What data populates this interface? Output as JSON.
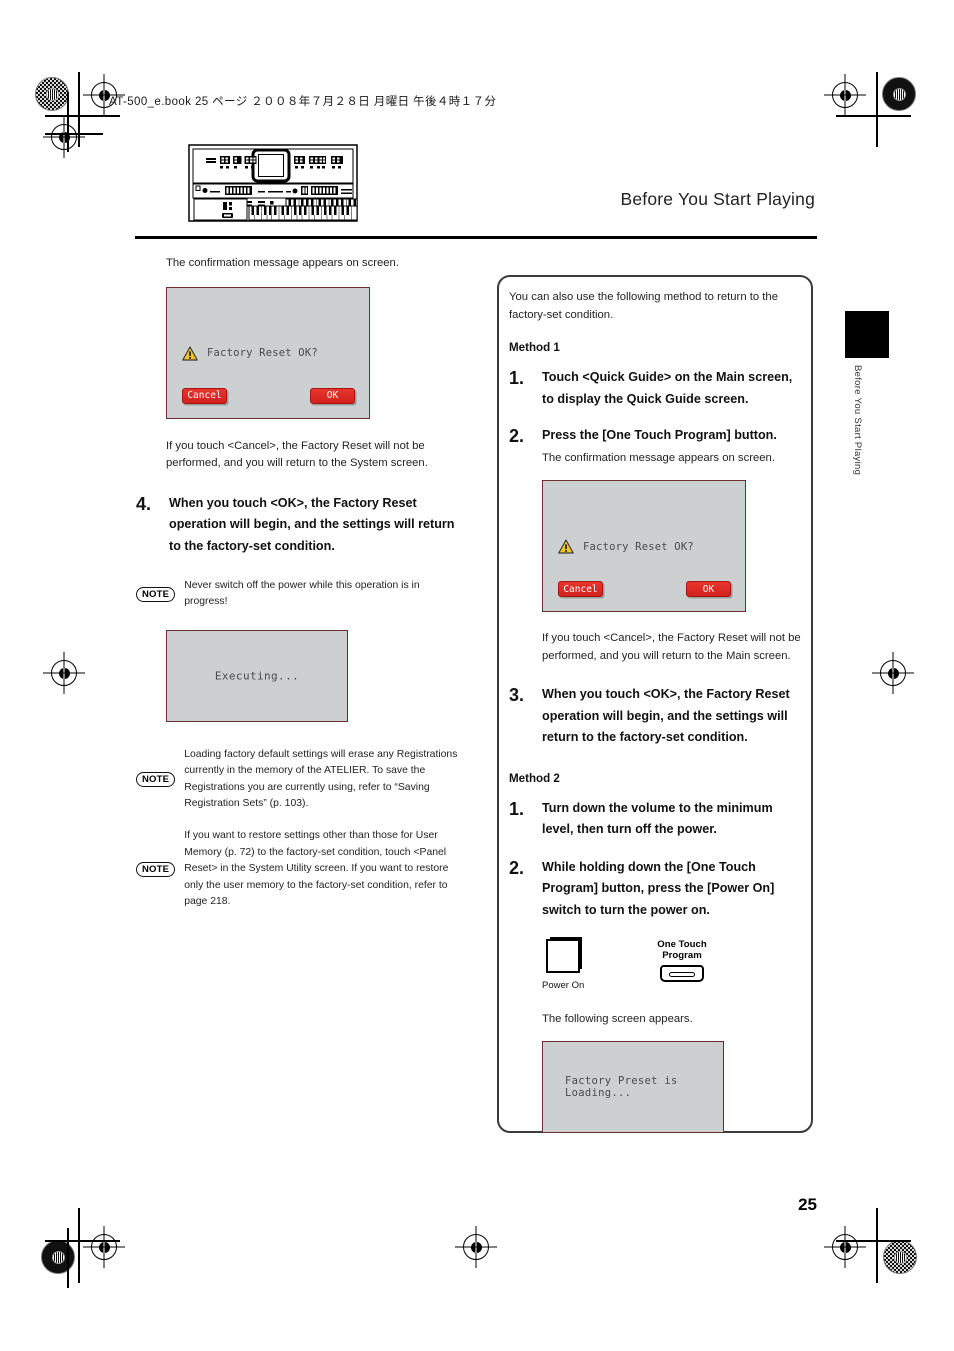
{
  "print": {
    "file_header": "AT-500_e.book 25 ページ ２００８年７月２８日 月曜日 午後４時１７分",
    "page_number": "25"
  },
  "header": {
    "section_title": "Before You Start Playing",
    "side_tab_label": "Before You Start Playing",
    "organ_alt": "atelier-organ-illustration"
  },
  "left_column": {
    "intro": "The confirmation message appears on screen.",
    "dialog": {
      "message": "Factory Reset OK?",
      "cancel_label": "Cancel",
      "ok_label": "OK",
      "warning_icon": "warning-triangle-icon",
      "screen_bg": "#ccd0d0",
      "border_color": "#6b2e2e",
      "button_color": "#d2221c"
    },
    "cancel_note": "If you touch <Cancel>, the Factory Reset will not be performed, and you will return to the System screen.",
    "step4": {
      "number": "4.",
      "text": "When you touch <OK>, the Factory Reset operation will begin, and the settings will return to the factory-set condition."
    },
    "note1": {
      "badge": "NOTE",
      "text": "Never switch off the power while this operation is in progress!"
    },
    "executing_screen": {
      "message": "Executing..."
    },
    "note2": {
      "badge": "NOTE",
      "text": "Loading factory default settings will erase any Registrations currently in the memory of the ATELIER. To save the Registrations you are currently using, refer to “Saving Registration Sets” (p. 103)."
    },
    "note3": {
      "badge": "NOTE",
      "text": "If you want to restore settings other than those for User Memory (p. 72) to the factory-set condition, touch <Panel Reset> in the System Utility screen. If you want to restore only the user memory to the factory-set condition, refer to page 218."
    }
  },
  "right_column": {
    "intro": "You can also use the following method to return to the factory-set condition.",
    "method1": {
      "heading": "Method 1",
      "steps": [
        {
          "number": "1.",
          "text": "Touch <Quick Guide> on the Main screen, to display the Quick Guide screen."
        },
        {
          "number": "2.",
          "text": "Press the [One Touch Program] button.",
          "sub": "The confirmation message appears on screen."
        },
        {
          "number": "3.",
          "text": "When you touch <OK>, the Factory Reset operation will begin, and the settings will return to the factory-set condition."
        }
      ],
      "dialog": {
        "message": "Factory Reset OK?",
        "cancel_label": "Cancel",
        "ok_label": "OK",
        "warning_icon": "warning-triangle-icon"
      },
      "cancel_note": "If you touch <Cancel>, the Factory Reset will not be performed, and you will return to the Main screen."
    },
    "method2": {
      "heading": "Method 2",
      "steps": [
        {
          "number": "1.",
          "text": "Turn down the volume to the minimum level, then turn off the power."
        },
        {
          "number": "2.",
          "text": "While holding down the [One Touch Program] button, press the [Power On] switch to turn the power on."
        }
      ],
      "power_on_label": "Power On",
      "one_touch_label_line1": "One Touch",
      "one_touch_label_line2": "Program",
      "following_screen": "The following screen appears.",
      "loading_screen": {
        "message": "Factory Preset is Loading..."
      }
    }
  }
}
